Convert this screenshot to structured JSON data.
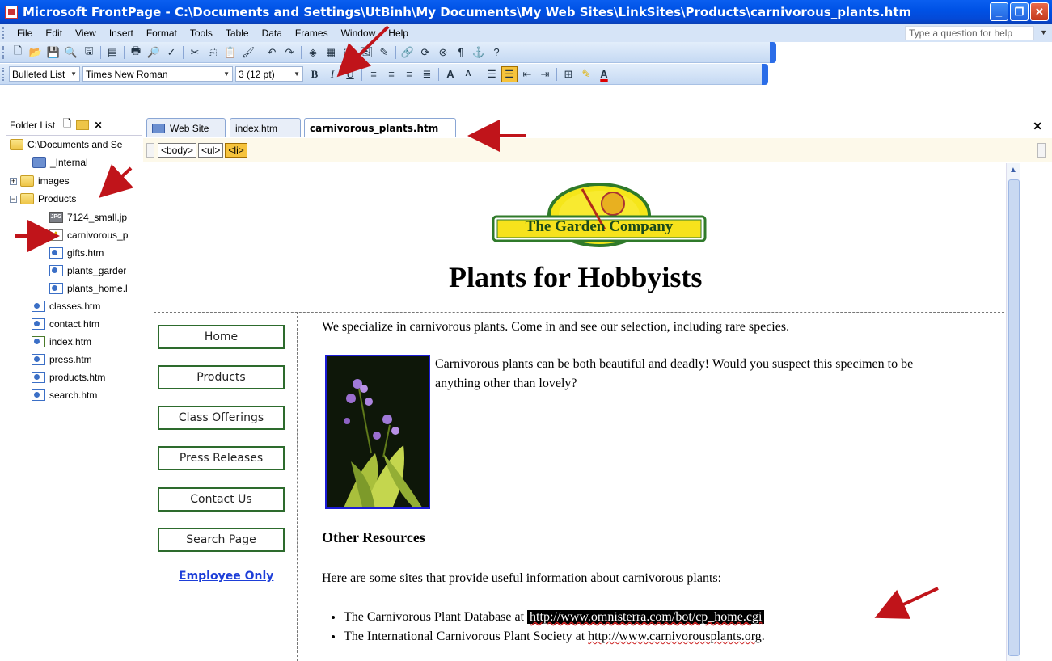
{
  "window": {
    "title": "Microsoft FrontPage - C:\\Documents and Settings\\UtBinh\\My Documents\\My Web Sites\\LinkSites\\Products\\carnivorous_plants.htm",
    "buttons": [
      "minimize",
      "restore",
      "close"
    ]
  },
  "menubar": {
    "items": [
      "File",
      "Edit",
      "View",
      "Insert",
      "Format",
      "Tools",
      "Table",
      "Data",
      "Frames",
      "Window",
      "Help"
    ],
    "help_placeholder": "Type a question for help"
  },
  "formatting": {
    "style": "Bulleted List",
    "font": "Times New Roman",
    "size": "3 (12 pt)"
  },
  "folder_list": {
    "title": "Folder List",
    "items": [
      {
        "label": "C:\\Documents and Se",
        "icon": "folder-icon"
      },
      {
        "label": "_Internal",
        "icon": "web-folder-icon"
      },
      {
        "label": "images",
        "icon": "folder-icon"
      },
      {
        "label": "Products",
        "icon": "folder-icon"
      },
      {
        "label": "7124_small.jp",
        "icon": "jpg-file-icon"
      },
      {
        "label": "carnivorous_p",
        "icon": "edit-page-icon"
      },
      {
        "label": "gifts.htm",
        "icon": "page-icon"
      },
      {
        "label": "plants_garder",
        "icon": "page-icon"
      },
      {
        "label": "plants_home.l",
        "icon": "page-icon"
      },
      {
        "label": "classes.htm",
        "icon": "page-icon"
      },
      {
        "label": "contact.htm",
        "icon": "page-icon"
      },
      {
        "label": "index.htm",
        "icon": "home-page-icon"
      },
      {
        "label": "press.htm",
        "icon": "page-icon"
      },
      {
        "label": "products.htm",
        "icon": "page-icon"
      },
      {
        "label": "search.htm",
        "icon": "page-icon"
      }
    ]
  },
  "tabs": [
    {
      "label": "Web Site"
    },
    {
      "label": "index.htm"
    },
    {
      "label": "carnivorous_plants.htm",
      "active": true
    }
  ],
  "quick_tags": [
    "<body>",
    "<ul>",
    "<li>"
  ],
  "page": {
    "logo_text": "The Garden Company",
    "heading": "Plants for Hobbyists",
    "nav_buttons": [
      "Home",
      "Products",
      "Class Offerings",
      "Press Releases",
      "Contact Us",
      "Search Page"
    ],
    "employee_link": "Employee Only",
    "intro": "We specialize in carnivorous plants. Come in and see our selection, including rare species.",
    "photo_caption_line1": "Carnivorous plants can be both beautiful and deadly! Would you suspect this specimen to be",
    "photo_caption_line2": "anything other than lovely?",
    "resources_heading": "Other Resources",
    "resources_intro": "Here are some sites that provide useful information about carnivorous plants:",
    "resources": [
      {
        "prefix": "The Carnivorous Plant Database at ",
        "url": "http://www.omnisterra.com/bot/cp_home.cgi"
      },
      {
        "prefix": "The International Carnivorous Plant Society at ",
        "url": "http://www.carnivorousplants.org",
        "suffix": "."
      }
    ]
  },
  "colors": {
    "title_blue": "#0052e6",
    "toolbar_bg": "#d6e4f7",
    "nav_border": "#2d6b2d",
    "link_blue": "#1d3ed8",
    "annotation_red": "#c0141a"
  }
}
